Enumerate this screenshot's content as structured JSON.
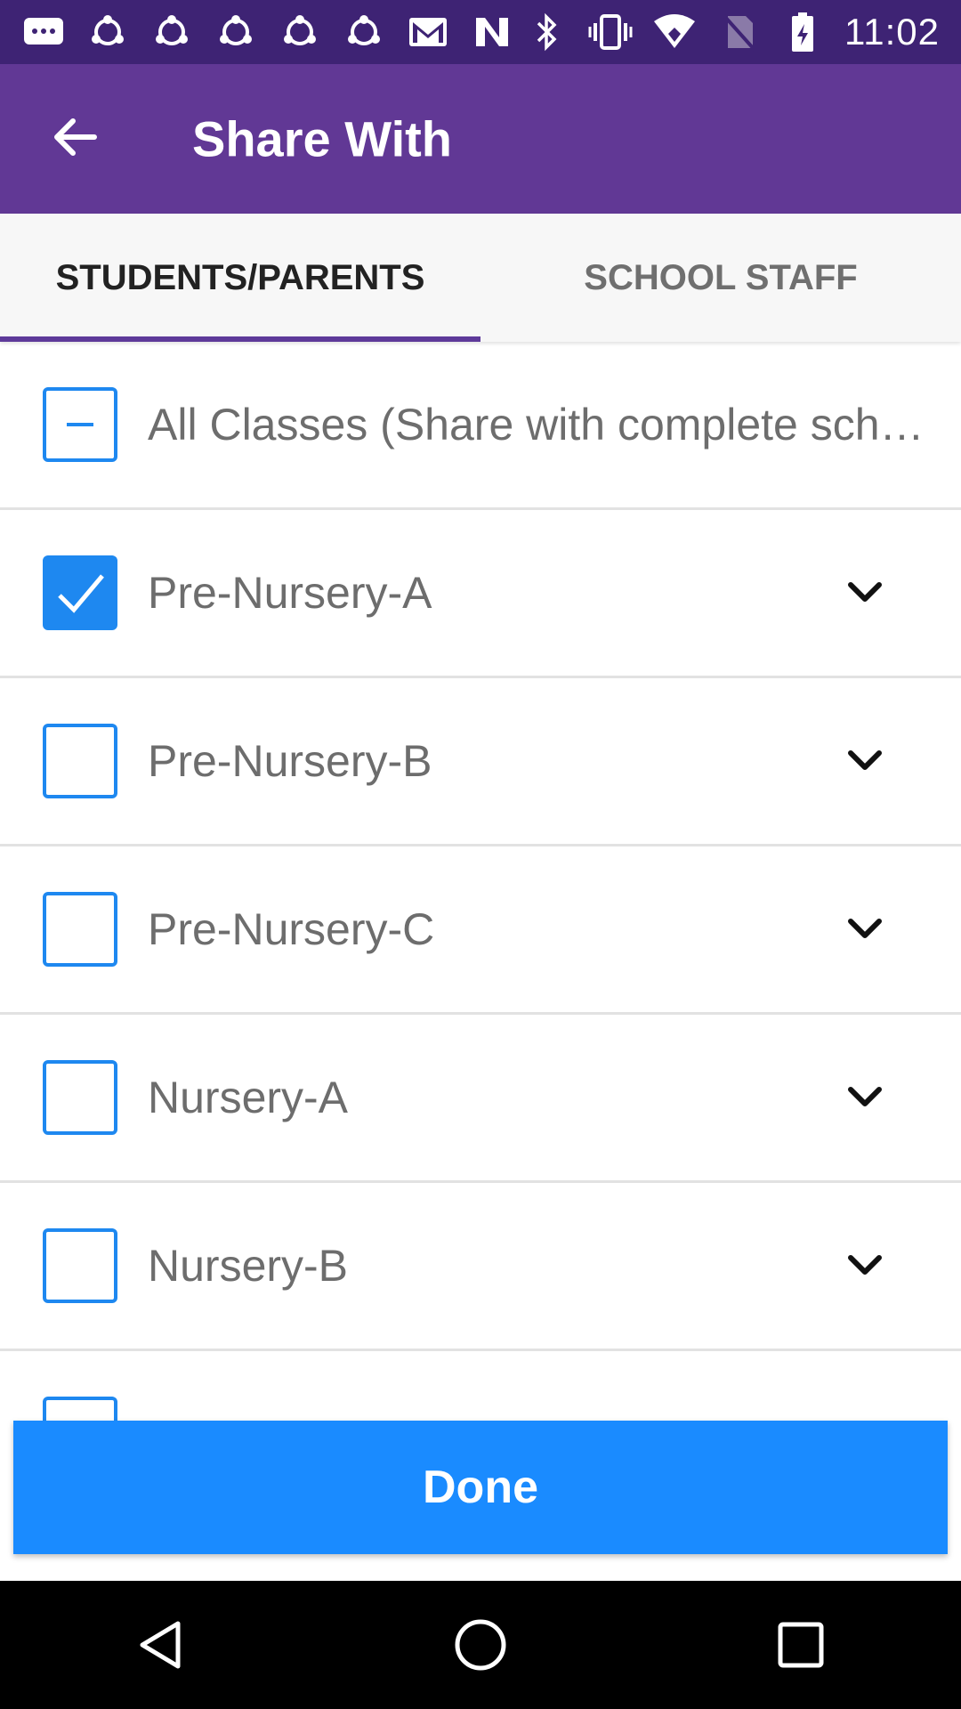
{
  "status_bar": {
    "time": "11:02",
    "left_icons": [
      "message-icon",
      "app-notification-icon",
      "app-notification-icon",
      "app-notification-icon",
      "app-notification-icon",
      "app-notification-icon",
      "gmail-icon",
      "n-icon"
    ],
    "right_icons": [
      "bluetooth-icon",
      "vibrate-icon",
      "wifi-icon",
      "no-sim-icon",
      "battery-icon"
    ]
  },
  "app_bar": {
    "title": "Share With",
    "back_icon": "arrow-back-icon"
  },
  "tabs": [
    {
      "label": "STUDENTS/PARENTS",
      "active": true
    },
    {
      "label": "SCHOOL STAFF",
      "active": false
    }
  ],
  "all_classes": {
    "label": "All Classes (Share with complete sch…",
    "state": "indeterminate"
  },
  "classes": [
    {
      "label": "Pre-Nursery-A",
      "checked": true
    },
    {
      "label": "Pre-Nursery-B",
      "checked": false
    },
    {
      "label": "Pre-Nursery-C",
      "checked": false
    },
    {
      "label": "Nursery-A",
      "checked": false
    },
    {
      "label": "Nursery-B",
      "checked": false
    }
  ],
  "done_button": {
    "label": "Done"
  },
  "colors": {
    "status_bar": "#3e2374",
    "app_bar": "#613895",
    "accent_blue": "#1a8bff",
    "tab_indicator": "#5e3a9a"
  }
}
